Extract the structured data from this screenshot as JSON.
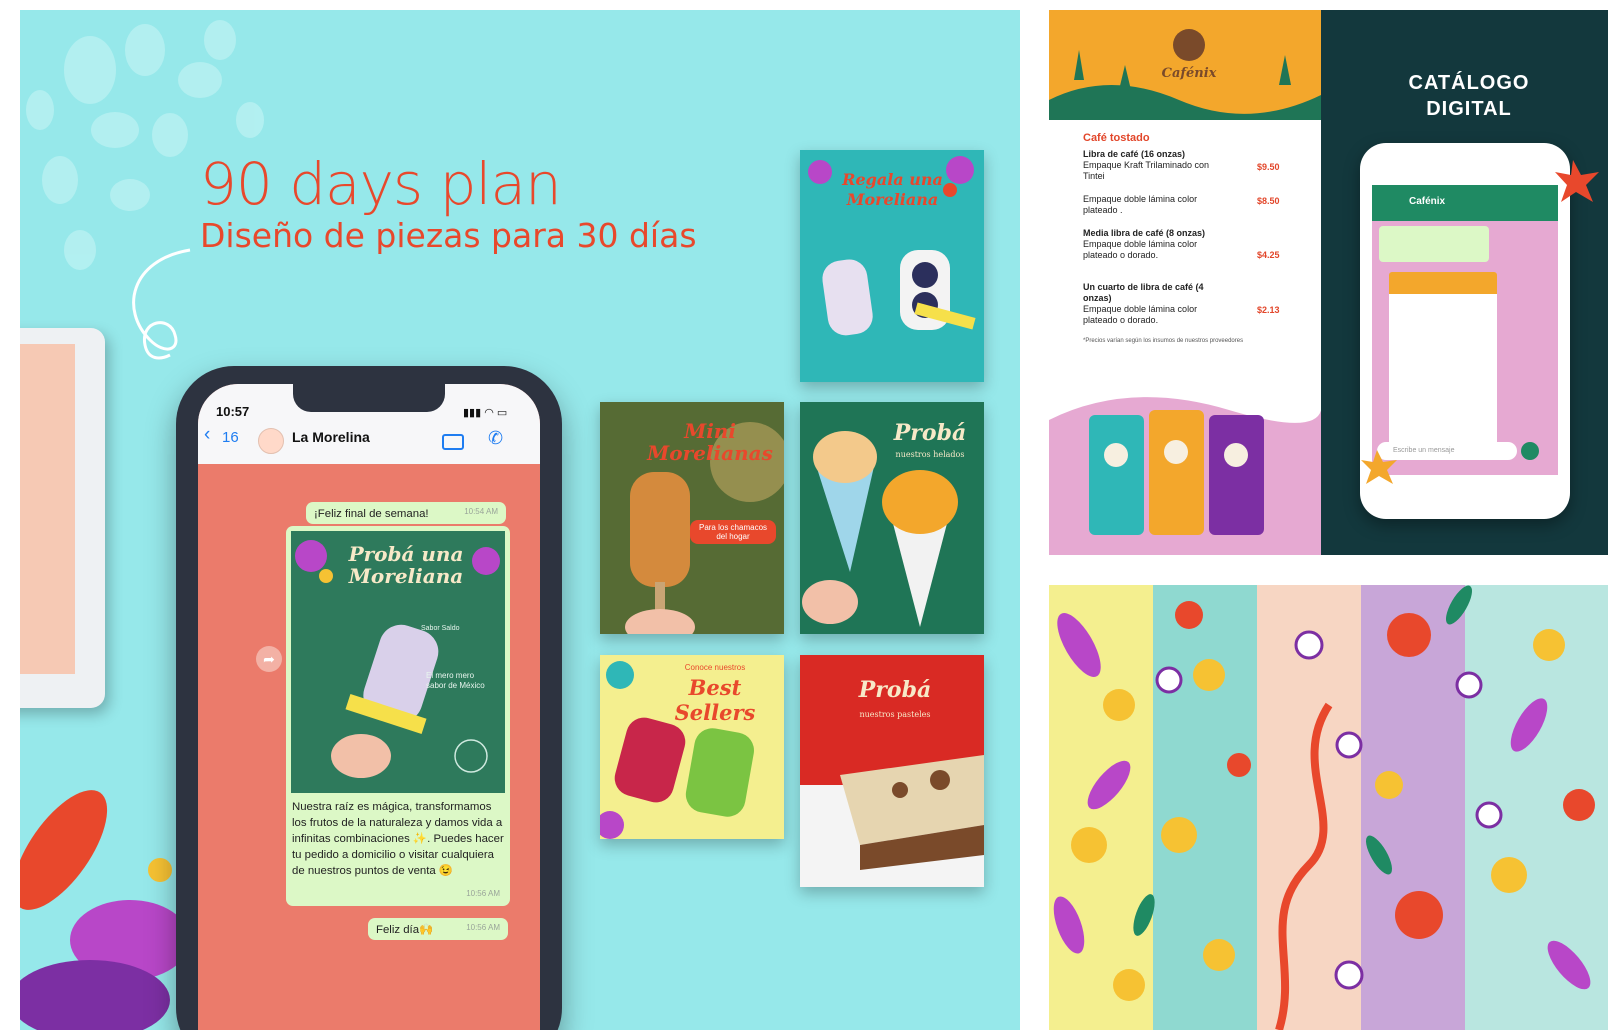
{
  "colors": {
    "left_bg": "#96e8ea",
    "title_red": "#e8482c",
    "chat_bg": "#eb7b6b",
    "bubble": "#dcf8c6",
    "ios_blue": "#1f7df1",
    "cafenix_orange": "#f3a72c",
    "catalog_dark": "#13383d"
  },
  "icons": [
    "back-chevron-icon",
    "video-call-icon",
    "phone-call-icon",
    "share-forward-icon",
    "read-check-icon",
    "signal-icon",
    "wifi-icon",
    "battery-icon"
  ],
  "promo": {
    "title": "90 days plan",
    "subtitle": "Diseño de piezas para 30 días"
  },
  "phone": {
    "time": "10:57",
    "back_count": "16",
    "contact_name": "La Morelina",
    "messages": [
      {
        "text": "¡Feliz final de semana!",
        "time": "10:54 AM"
      },
      {
        "image_title": "Probá una Moreliana",
        "image_label_1": "Sabor Saldo",
        "image_label_2": "El mero mero sabor de México",
        "text": "Nuestra raíz es mágica, transformamos los frutos de la naturaleza y damos vida a infinitas combinaciones ✨. Puedes hacer tu pedido a domicilio o visitar cualquiera de nuestros puntos de venta 😉",
        "time": "10:56 AM"
      },
      {
        "text": "Feliz día🙌",
        "time": "10:56 AM"
      }
    ]
  },
  "posts": [
    {
      "title": "Regala una Moreliana"
    },
    {
      "title": "Mini Morelianas",
      "tag": "Para los chamacos del hogar"
    },
    {
      "title": "Probá",
      "subtitle": "nuestros helados"
    },
    {
      "title": "Best Sellers",
      "pre": "Conoce nuestros"
    },
    {
      "title": "Probá",
      "subtitle": "nuestros pasteles"
    }
  ],
  "catalog": {
    "brand": "Cafénix",
    "heading_line1": "CATÁLOGO",
    "heading_line2": "DIGITAL",
    "section": "Café tostado",
    "items": [
      {
        "name": "Libra de café (16 onzas)",
        "desc": "Empaque Kraft Trilaminado con Tintei",
        "price": "$9.50"
      },
      {
        "name": "",
        "desc": "Empaque doble lámina color plateado .",
        "price": "$8.50"
      },
      {
        "name": "Media libra de café (8 onzas)",
        "desc": "Empaque doble lámina color plateado o dorado.",
        "price": "$4.25"
      },
      {
        "name": "Un cuarto de libra de café (4 onzas)",
        "desc": "Empaque doble lámina color plateado o dorado.",
        "price": "$2.13"
      }
    ],
    "note": "*Precios varían según los insumos de nuestros proveedores",
    "chat_contact": "Cafénix",
    "chat_placeholder": "Escribe un mensaje"
  }
}
